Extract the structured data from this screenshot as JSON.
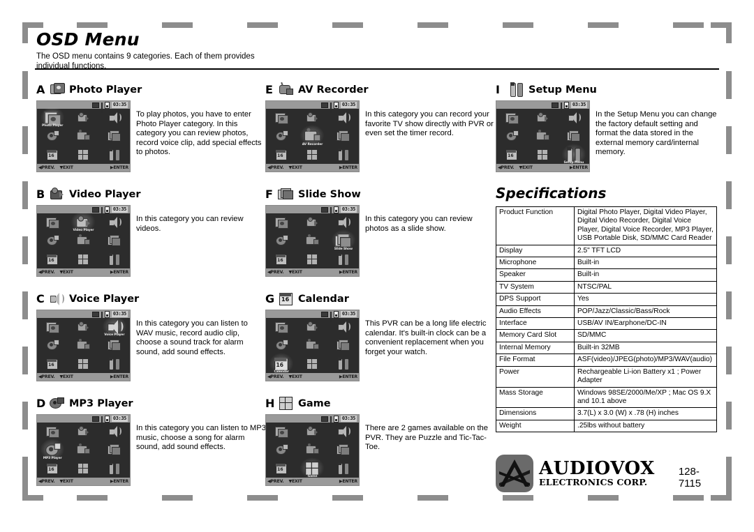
{
  "header": {
    "title": "OSD Menu",
    "subtitle": "The OSD menu contains 9 categories. Each of them provides individual functions."
  },
  "lcd": {
    "time": "03:35",
    "prev_label": "PREV.",
    "exit_label": "EXIT",
    "enter_label": "ENTER",
    "menu_items": [
      "Photo Player",
      "Video Player",
      "Voice Player",
      "MP3 Player",
      "AV Recorder",
      "Slide Show",
      "Calendar",
      "Game",
      "Setup Menu"
    ]
  },
  "entries": [
    {
      "letter": "A",
      "name": "Photo Player",
      "icon": "photo-player-icon",
      "selected": 0,
      "description": "To play photos, you have to enter Photo Player category. In this category you can review photos, record voice clip, add special effects to photos."
    },
    {
      "letter": "B",
      "name": "Video Player",
      "icon": "video-player-icon",
      "selected": 1,
      "description": "In this category you can review videos."
    },
    {
      "letter": "C",
      "name": "Voice Player",
      "icon": "voice-player-icon",
      "selected": 2,
      "description": "In this category you can listen to WAV music, record audio clip, choose a sound track for alarm sound, add sound effects."
    },
    {
      "letter": "D",
      "name": "MP3 Player",
      "icon": "mp3-player-icon",
      "selected": 3,
      "description": "In this category you can listen to MP3 music, choose a song for alarm sound, add sound effects."
    },
    {
      "letter": "E",
      "name": "AV Recorder",
      "icon": "av-recorder-icon",
      "selected": 4,
      "description": "In this category you can record your favorite TV show directly with PVR or even set the timer record."
    },
    {
      "letter": "F",
      "name": "Slide Show",
      "icon": "slide-show-icon",
      "selected": 5,
      "description": "In this category you can review photos as a slide show."
    },
    {
      "letter": "G",
      "name": "Calendar",
      "icon": "calendar-icon",
      "selected": 6,
      "description": "This PVR can be a long life electric calendar. It's built-in clock can be a convenient replacement when you forget your watch."
    },
    {
      "letter": "H",
      "name": "Game",
      "icon": "game-icon",
      "selected": 7,
      "description": "There are 2 games available on the PVR. They are Puzzle and Tic-Tac-Toe."
    },
    {
      "letter": "I",
      "name": "Setup Menu",
      "icon": "setup-menu-icon",
      "selected": 8,
      "description": "In the Setup Menu you can change the factory default setting and format the data stored in the external memory card/internal memory."
    }
  ],
  "specifications": {
    "title": "Specifications",
    "rows": [
      {
        "key": "Product Function",
        "value": "Digital Photo Player, Digital Video Player, Digital Video Recorder, Digital Voice Player, Digital Voice Recorder, MP3 Player, USB Portable Disk, SD/MMC Card Reader"
      },
      {
        "key": "Display",
        "value": "2.5\" TFT LCD"
      },
      {
        "key": "Microphone",
        "value": "Built-in"
      },
      {
        "key": "Speaker",
        "value": "Built-in"
      },
      {
        "key": "TV System",
        "value": "NTSC/PAL"
      },
      {
        "key": "DPS Support",
        "value": "Yes"
      },
      {
        "key": "Audio Effects",
        "value": "POP/Jazz/Classic/Bass/Rock"
      },
      {
        "key": "Interface",
        "value": "USB/AV IN/Earphone/DC-IN"
      },
      {
        "key": "Memory Card Slot",
        "value": "SD/MMC"
      },
      {
        "key": "Internal Memory",
        "value": "Built-in 32MB"
      },
      {
        "key": "File Format",
        "value": "ASF(video)/JPEG(photo)/MP3/WAV(audio)"
      },
      {
        "key": "Power",
        "value": "Rechargeable Li-ion Battery x1 ; Power Adapter"
      },
      {
        "key": "Mass Storage",
        "value": "Windows 98SE/2000/Me/XP ; Mac OS 9.X and 10.1 above"
      },
      {
        "key": "Dimensions",
        "value": "3.7(L) x 3.0 (W) x .78 (H) inches"
      },
      {
        "key": "Weight",
        "value": ".25lbs without battery"
      }
    ]
  },
  "footer": {
    "brand": "AUDIOVOX",
    "brand_sub": "ELECTRONICS CORP.",
    "part_number": "128-7115"
  },
  "colors": {
    "frame": "#8d8d8d",
    "lcd_background": "#2c2c2c",
    "lcd_bar": "#9a9a9a",
    "text": "#000000"
  }
}
